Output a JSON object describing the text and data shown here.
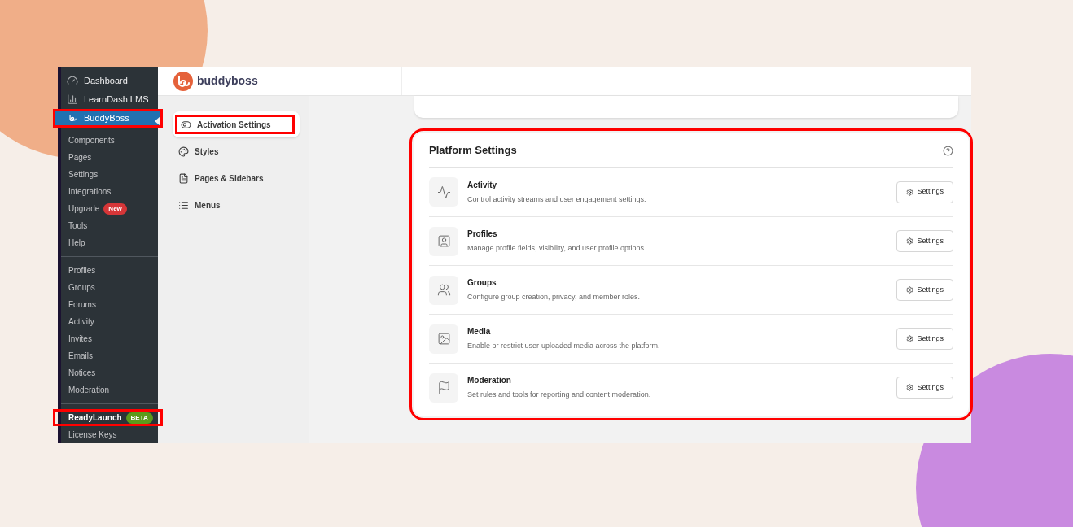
{
  "wp_menu": {
    "top_items": [
      {
        "label": "Dashboard",
        "selected": false,
        "highlighted": false
      },
      {
        "label": "LearnDash LMS",
        "selected": false,
        "highlighted": false
      },
      {
        "label": "BuddyBoss",
        "selected": true,
        "highlighted": true
      }
    ],
    "sections": [
      [
        {
          "label": "Components",
          "selected": false,
          "highlighted": false
        },
        {
          "label": "Pages",
          "selected": false,
          "highlighted": false
        },
        {
          "label": "Settings",
          "selected": false,
          "highlighted": false
        },
        {
          "label": "Integrations",
          "selected": false,
          "highlighted": false
        },
        {
          "label": "Upgrade",
          "selected": false,
          "highlighted": false,
          "badge": {
            "text": "New",
            "color": "#d63638"
          }
        },
        {
          "label": "Tools",
          "selected": false,
          "highlighted": false
        },
        {
          "label": "Help",
          "selected": false,
          "highlighted": false
        }
      ],
      [
        {
          "label": "Profiles",
          "selected": false,
          "highlighted": false
        },
        {
          "label": "Groups",
          "selected": false,
          "highlighted": false
        },
        {
          "label": "Forums",
          "selected": false,
          "highlighted": false
        },
        {
          "label": "Activity",
          "selected": false,
          "highlighted": false
        },
        {
          "label": "Invites",
          "selected": false,
          "highlighted": false
        },
        {
          "label": "Emails",
          "selected": false,
          "highlighted": false
        },
        {
          "label": "Notices",
          "selected": false,
          "highlighted": false
        },
        {
          "label": "Moderation",
          "selected": false,
          "highlighted": false
        }
      ],
      [
        {
          "label": "ReadyLaunch",
          "selected": true,
          "highlighted": true,
          "badge": {
            "text": "BETA",
            "color": "#5c9a1b"
          }
        },
        {
          "label": "License Keys",
          "selected": false,
          "highlighted": false
        }
      ]
    ]
  },
  "header": {
    "logo_text": "buddyboss"
  },
  "plugin_nav": [
    {
      "label": "Activation Settings",
      "selected": true,
      "highlighted": true
    },
    {
      "label": "Styles",
      "selected": false,
      "highlighted": false
    },
    {
      "label": "Pages & Sidebars",
      "selected": false,
      "highlighted": false
    },
    {
      "label": "Menus",
      "selected": false,
      "highlighted": false
    }
  ],
  "platform_settings": {
    "title": "Platform Settings",
    "highlighted": true,
    "rows": [
      {
        "title": "Activity",
        "description": "Control activity streams and user engagement settings.",
        "button": "Settings"
      },
      {
        "title": "Profiles",
        "description": "Manage profile fields, visibility, and user profile options.",
        "button": "Settings"
      },
      {
        "title": "Groups",
        "description": "Configure group creation, privacy, and member roles.",
        "button": "Settings"
      },
      {
        "title": "Media",
        "description": "Enable or restrict user-uploaded media across the platform.",
        "button": "Settings"
      },
      {
        "title": "Moderation",
        "description": "Set rules and tools for reporting and content moderation.",
        "button": "Settings"
      }
    ]
  }
}
